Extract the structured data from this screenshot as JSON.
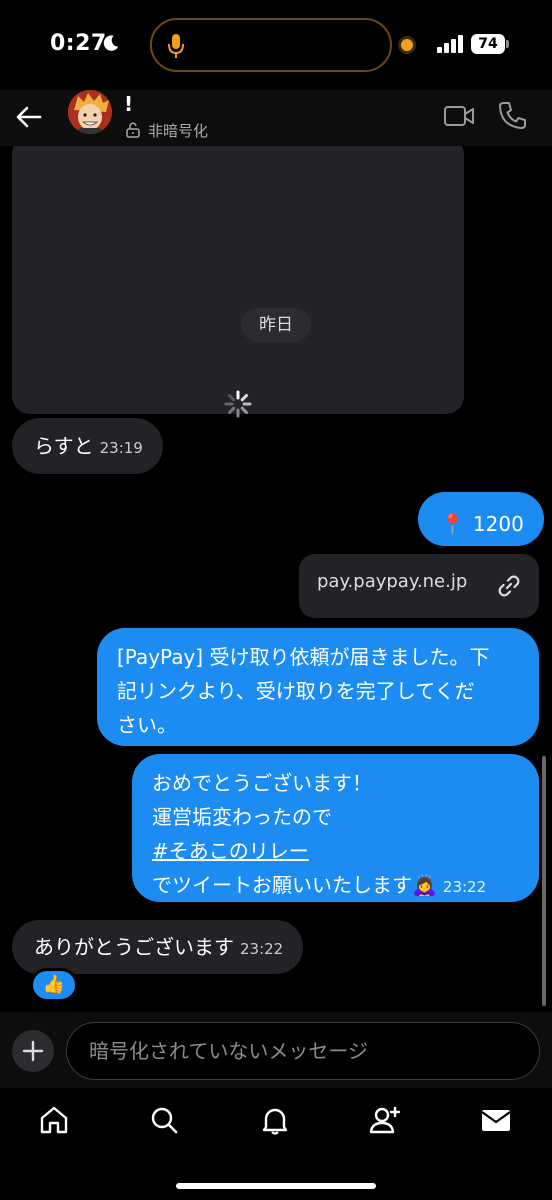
{
  "status_bar": {
    "time": "0:27",
    "battery": "74"
  },
  "header": {
    "contact_name": "!",
    "encryption_status": "非暗号化"
  },
  "chat": {
    "date_separator": "昨日",
    "messages": [
      {
        "direction": "in",
        "text": "らすと",
        "time": "23:19"
      },
      {
        "direction": "out",
        "emoji": "📍",
        "text": "1200"
      },
      {
        "direction": "out",
        "link": "pay.paypay.ne.jp"
      },
      {
        "direction": "out",
        "lines": [
          "[PayPay] 受け取り依頼が届きました。下",
          "記リンクより、受け取りを完了してくだ",
          "さい。"
        ]
      },
      {
        "direction": "out",
        "lines": [
          "おめでとうございます！",
          "運営垢変わったので",
          "#そあこのリレー",
          "でツイートお願いいたします🙇‍♀️"
        ],
        "time": "23:22"
      },
      {
        "direction": "in",
        "text": "ありがとうございます",
        "time": "23:22",
        "reaction": "👍"
      }
    ]
  },
  "composer": {
    "placeholder": "暗号化されていないメッセージ"
  },
  "colors": {
    "outgoing_bubble": "#1d8cf2",
    "incoming_bubble": "#212327",
    "background": "#000000"
  },
  "icons": [
    "back-arrow-icon",
    "lock-icon",
    "video-icon",
    "phone-icon",
    "link-icon",
    "plus-icon",
    "home-icon",
    "search-icon",
    "bell-icon",
    "add-person-icon",
    "mail-icon"
  ]
}
